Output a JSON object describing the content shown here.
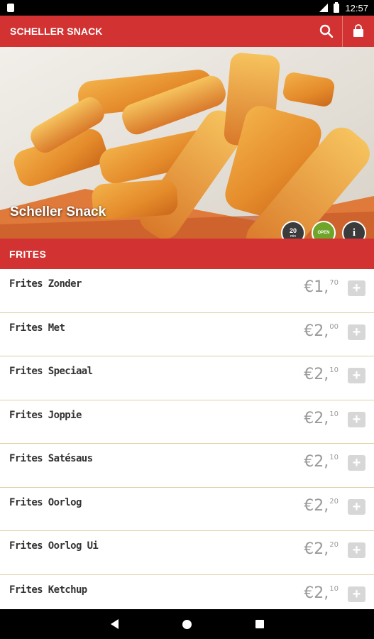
{
  "status_bar": {
    "time": "12:57"
  },
  "app_bar": {
    "title": "SCHELLER SNACK"
  },
  "hero": {
    "restaurant_name": "Scheller Snack",
    "delivery_time_value": "20",
    "delivery_time_unit": "min",
    "status_label": "OPEN",
    "info_symbol": "i"
  },
  "category": {
    "title": "FRITES"
  },
  "menu_items": [
    {
      "name": "Frites Zonder",
      "price_main": "€1,",
      "price_cents": "70"
    },
    {
      "name": "Frites Met",
      "price_main": "€2,",
      "price_cents": "00"
    },
    {
      "name": "Frites Speciaal",
      "price_main": "€2,",
      "price_cents": "10"
    },
    {
      "name": "Frites Joppie",
      "price_main": "€2,",
      "price_cents": "10"
    },
    {
      "name": "Frites Satésaus",
      "price_main": "€2,",
      "price_cents": "10"
    },
    {
      "name": "Frites Oorlog",
      "price_main": "€2,",
      "price_cents": "20"
    },
    {
      "name": "Frites Oorlog Ui",
      "price_main": "€2,",
      "price_cents": "20"
    },
    {
      "name": "Frites Ketchup",
      "price_main": "€2,",
      "price_cents": "10"
    }
  ],
  "add_button_symbol": "+",
  "icons": {
    "search": "search-icon",
    "cart": "shopping-bag-icon",
    "info": "info-icon",
    "back": "back-icon",
    "home": "home-icon",
    "recents": "recents-icon"
  },
  "colors": {
    "brand_red": "#d23232",
    "open_green": "#6ea52a",
    "badge_dark": "#3b3b3b",
    "price_gray": "#9a9a9a",
    "divider_tan": "#e0cfa5"
  }
}
